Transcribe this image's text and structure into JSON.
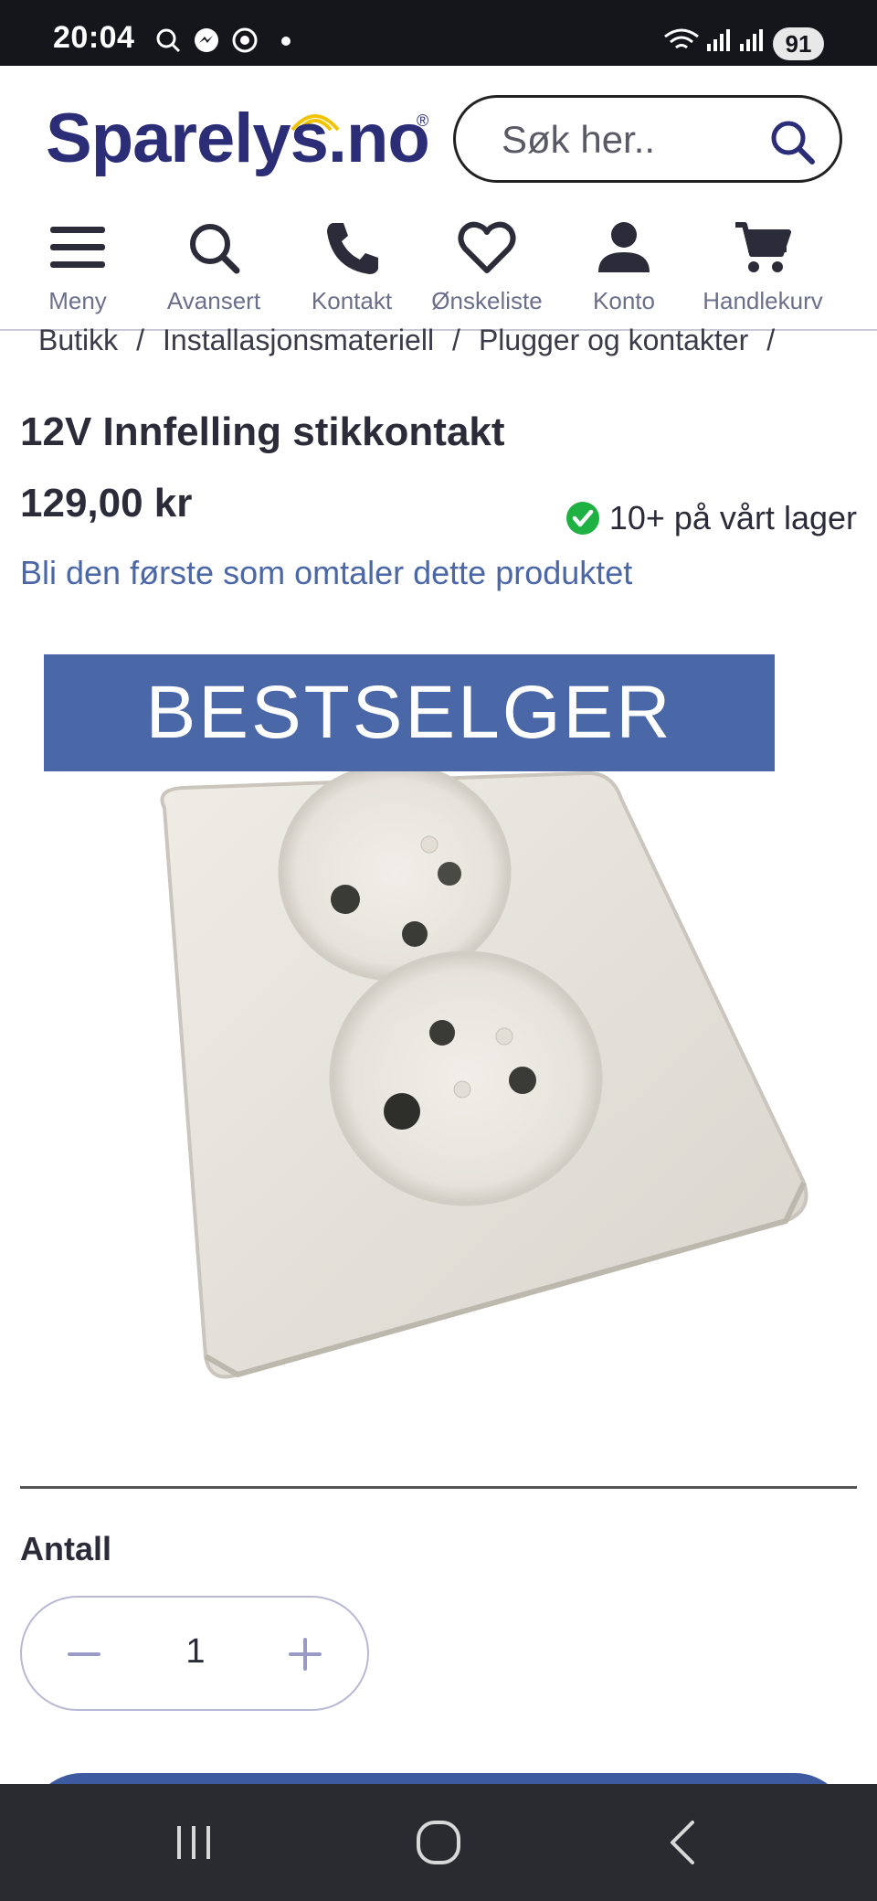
{
  "status_bar": {
    "time": "20:04",
    "battery": "91",
    "icons": [
      "search-icon",
      "messenger-icon",
      "chrome-icon",
      "dot-icon",
      "wifi-icon",
      "signal-icon",
      "signal-icon"
    ]
  },
  "header": {
    "logo_text": "Sparelys.no",
    "logo_reg": "®",
    "search_placeholder": "Søk her..",
    "brand_color": "#2b2d77",
    "accent_color": "#4a67a8"
  },
  "nav": {
    "items": [
      {
        "label": "Meny",
        "icon": "hamburger-icon"
      },
      {
        "label": "Avansert",
        "icon": "search-icon"
      },
      {
        "label": "Kontakt",
        "icon": "phone-icon"
      },
      {
        "label": "Ønskeliste",
        "icon": "heart-icon"
      },
      {
        "label": "Konto",
        "icon": "user-icon"
      },
      {
        "label": "Handlekurv",
        "icon": "cart-icon"
      }
    ]
  },
  "breadcrumb": [
    "Butikk",
    "Installasjonsmateriell",
    "Plugger og kontakter"
  ],
  "product": {
    "title": "12V Innfelling stikkontakt",
    "price": "129,00 kr",
    "stock": "10+ på vårt lager",
    "review_link": "Bli den første som omtaler dette produktet",
    "badge": "BESTSELGER"
  },
  "quantity": {
    "label": "Antall",
    "value": "1"
  }
}
